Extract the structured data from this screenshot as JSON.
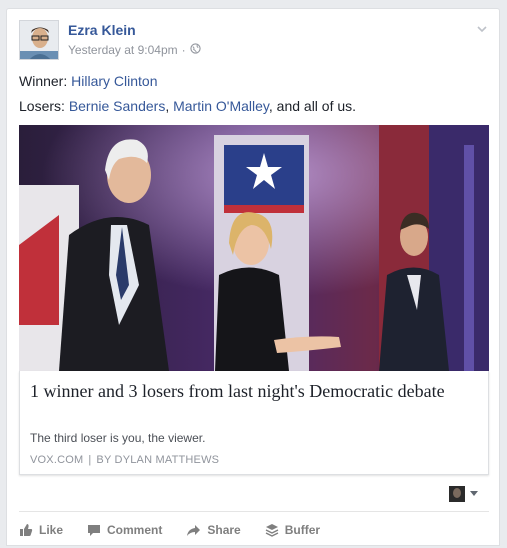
{
  "post": {
    "author": "Ezra Klein",
    "timestamp": "Yesterday at 9:04pm",
    "separator": "·",
    "line1_prefix": "Winner: ",
    "line1_link": "Hillary Clinton",
    "line2_prefix": "Losers: ",
    "line2_link1": "Bernie Sanders",
    "line2_comma": ", ",
    "line2_link2": "Martin O'Malley",
    "line2_suffix": ", and all of us."
  },
  "link": {
    "title": "1 winner and 3 losers from last night's Democratic debate",
    "description": "The third loser is you, the viewer.",
    "source": "VOX.COM",
    "divider": "|",
    "byline": "BY DYLAN MATTHEWS"
  },
  "actions": {
    "like": "Like",
    "comment": "Comment",
    "share": "Share",
    "buffer": "Buffer"
  },
  "icons": [
    "globe-icon",
    "chevron-down-icon",
    "like-icon",
    "comment-icon",
    "share-icon",
    "buffer-icon"
  ],
  "colors": {
    "link": "#365899",
    "meta": "#90949c",
    "action": "#7f7f7f",
    "background": "#e9ebee"
  }
}
